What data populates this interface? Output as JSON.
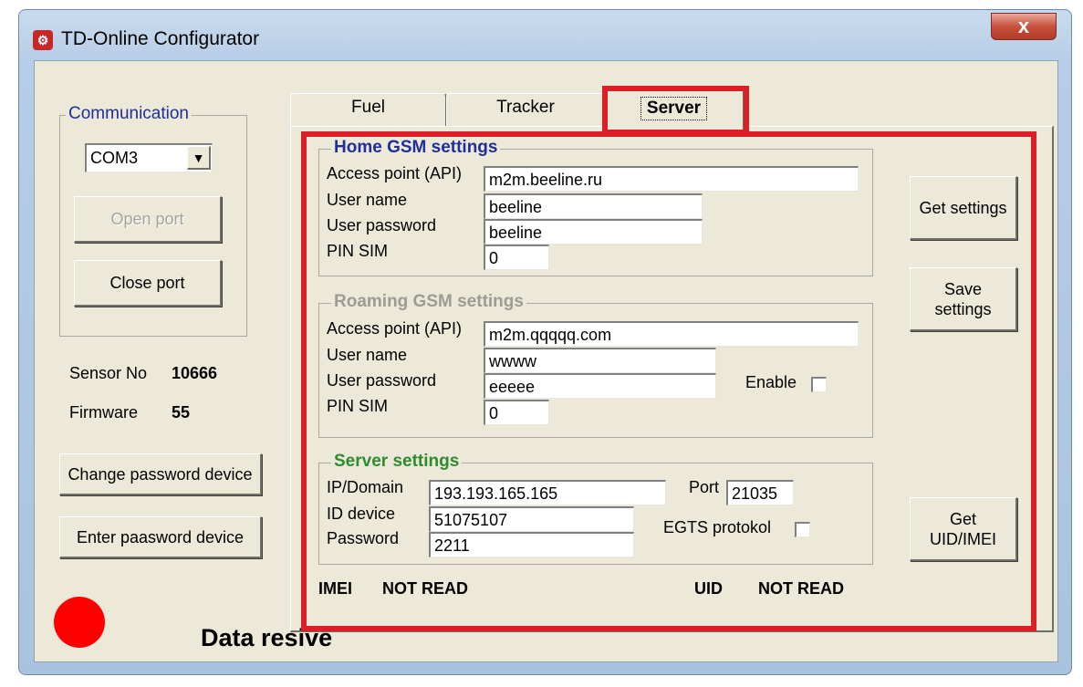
{
  "window": {
    "title": "TD-Online Configurator",
    "close_glyph": "x"
  },
  "communication": {
    "legend": "Communication",
    "port_value": "COM3",
    "open_port_label": "Open port",
    "close_port_label": "Close port"
  },
  "device": {
    "sensor_label": "Sensor No",
    "sensor_value": "10666",
    "firmware_label": "Firmware",
    "firmware_value": "55"
  },
  "actions": {
    "change_password_label": "Change password device",
    "enter_password_label": "Enter paasword device"
  },
  "status": {
    "indicator_color": "#ff0000",
    "text": "Data resive"
  },
  "tabs": [
    {
      "label": "Fuel"
    },
    {
      "label": "Tracker"
    },
    {
      "label": "Server",
      "active": true
    }
  ],
  "home_gsm": {
    "legend": "Home GSM settings",
    "access_point_label": "Access point (API)",
    "access_point_value": "m2m.beeline.ru",
    "user_name_label": "User name",
    "user_name_value": "beeline",
    "user_password_label": "User password",
    "user_password_value": "beeline",
    "pin_label": "PIN SIM",
    "pin_value": "0"
  },
  "roaming_gsm": {
    "legend": "Roaming GSM settings",
    "access_point_label": "Access point (API)",
    "access_point_value": "m2m.qqqqq.com",
    "user_name_label": "User name",
    "user_name_value": "wwww",
    "user_password_label": "User password",
    "user_password_value": "eeeee",
    "pin_label": "PIN SIM",
    "pin_value": "0",
    "enable_label": "Enable",
    "enable_checked": false
  },
  "server": {
    "legend": "Server settings",
    "ip_label": "IP/Domain",
    "ip_value": "193.193.165.165",
    "port_label": "Port",
    "port_value": "21035",
    "id_label": "ID device",
    "id_value": "51075107",
    "password_label": "Password",
    "password_value": "2211",
    "egts_label": "EGTS protokol",
    "egts_checked": false
  },
  "buttons": {
    "get_settings_label": "Get settings",
    "save_settings_label": "Save settings",
    "get_uid_label": "Get UID/IMEI"
  },
  "ids": {
    "imei_label": "IMEI",
    "imei_value": "NOT READ",
    "uid_label": "UID",
    "uid_value": "NOT READ"
  },
  "colors": {
    "home_legend": "#1f2e9c",
    "roaming_legend": "#9d9b94",
    "server_legend": "#2e8b2e",
    "highlight": "#dc1f26"
  }
}
